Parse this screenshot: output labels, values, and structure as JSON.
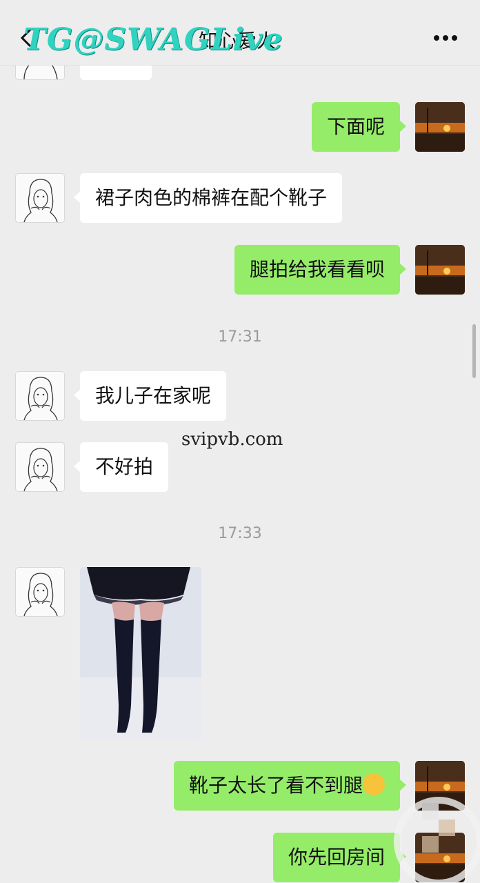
{
  "header": {
    "watermark": "TG@SWAGLive",
    "title": "知心爱人"
  },
  "icons": {
    "back": "chevron-left-icon",
    "more": "more-dots-icon"
  },
  "overlay": {
    "site_watermark": "svipvb.com"
  },
  "messages": [
    {
      "from": "me",
      "text": "下面呢"
    },
    {
      "from": "contact",
      "text": "裙子肉色的棉裤在配个靴子"
    },
    {
      "from": "me",
      "text": "腿拍给我看看呗"
    },
    {
      "time": "17:31"
    },
    {
      "from": "contact",
      "text": "我儿子在家呢"
    },
    {
      "from": "contact",
      "text": "不好拍"
    },
    {
      "time": "17:33"
    },
    {
      "from": "contact",
      "type": "image"
    },
    {
      "from": "me",
      "text": "靴子太长了看不到腿",
      "emoji": "crying-face-emoji"
    },
    {
      "from": "me",
      "text": "你先回房间"
    }
  ],
  "colors": {
    "background": "#ededed",
    "incoming_bubble": "#ffffff",
    "outgoing_bubble": "#95ec69",
    "watermark": "#2fd3c0"
  }
}
